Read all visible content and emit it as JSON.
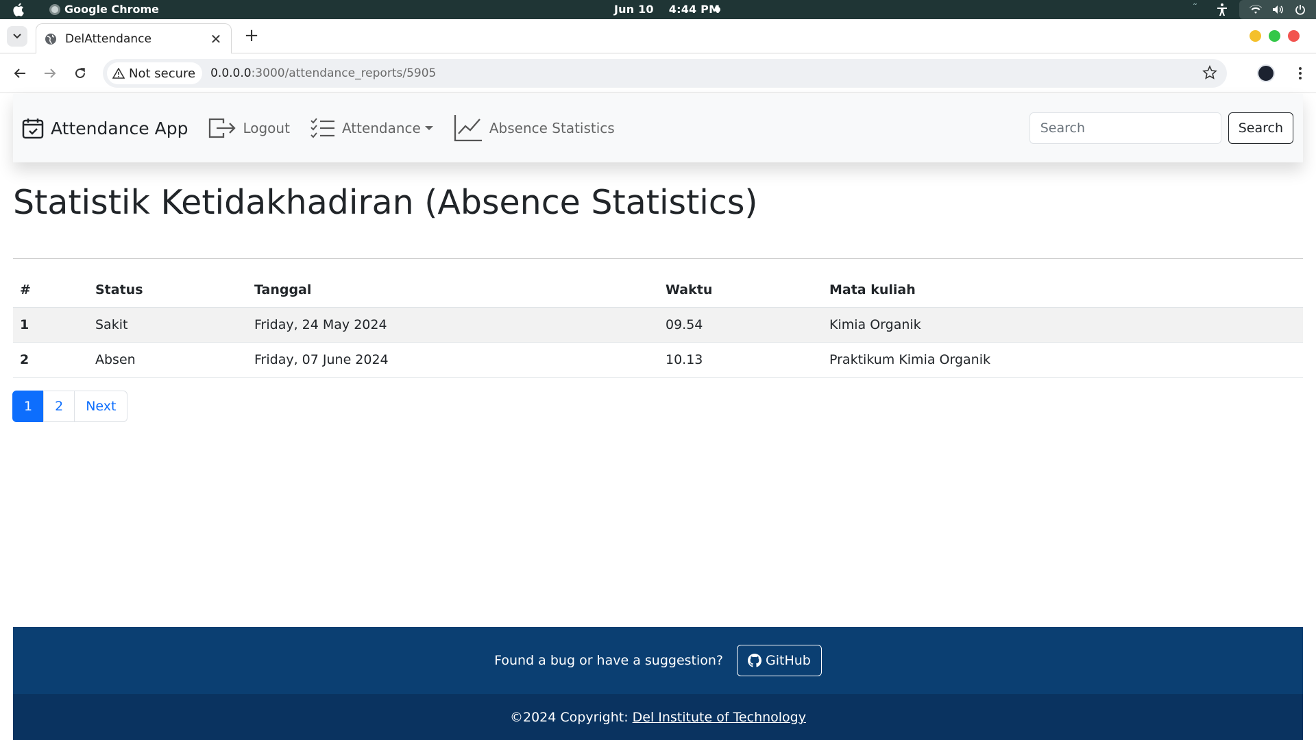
{
  "os": {
    "app_name": "Google Chrome",
    "date": "Jun 10",
    "time": "4:44 PM"
  },
  "browser": {
    "tab_title": "DelAttendance",
    "security_label": "Not secure",
    "url_host": "0.0.0.0",
    "url_path": ":3000/attendance_reports/5905"
  },
  "navbar": {
    "brand": "Attendance App",
    "logout": "Logout",
    "attendance": "Attendance",
    "absence_statistics": "Absence Statistics",
    "search_placeholder": "Search",
    "search_button": "Search"
  },
  "page": {
    "title": "Statistik Ketidakhadiran (Absence Statistics)"
  },
  "table": {
    "headers": [
      "#",
      "Status",
      "Tanggal",
      "Waktu",
      "Mata kuliah"
    ],
    "rows": [
      [
        "1",
        "Sakit",
        "Friday, 24 May 2024",
        "09.54",
        "Kimia Organik"
      ],
      [
        "2",
        "Absen",
        "Friday, 07 June 2024",
        "10.13",
        "Praktikum Kimia Organik"
      ]
    ]
  },
  "pagination": {
    "pages": [
      "1",
      "2"
    ],
    "current": "1",
    "next": "Next"
  },
  "footer": {
    "prompt": "Found a bug or have a suggestion?",
    "github": "GitHub",
    "copyright": "©2024 Copyright:",
    "institute": "Del Institute of Technology"
  },
  "colors": {
    "primary": "#0d6efd",
    "footer_top": "#0b3f72",
    "footer_bottom": "#0a3360",
    "navbar_bg": "#f8f9fa"
  }
}
